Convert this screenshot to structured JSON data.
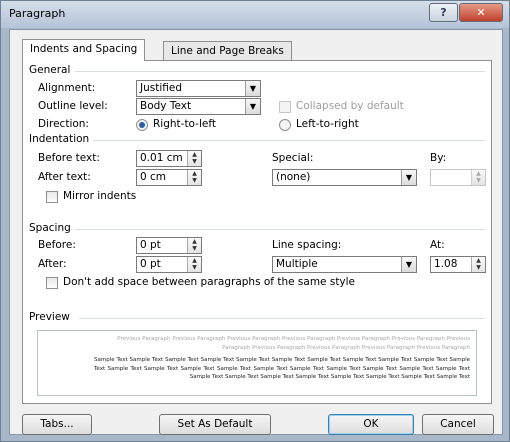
{
  "window": {
    "title": "Paragraph",
    "help_glyph": "?",
    "close_glyph": "✕"
  },
  "tabs": [
    {
      "label": "Indents and Spacing",
      "active": true
    },
    {
      "label": "Line and Page Breaks",
      "active": false
    }
  ],
  "general": {
    "heading": "General",
    "alignment_label": "Alignment:",
    "alignment_value": "Justified",
    "outline_label": "Outline level:",
    "outline_value": "Body Text",
    "collapsed_label": "Collapsed by default",
    "direction_label": "Direction:",
    "rtl_label": "Right-to-left",
    "ltr_label": "Left-to-right",
    "direction_value": "Right-to-left"
  },
  "indentation": {
    "heading": "Indentation",
    "before_label": "Before text:",
    "before_value": "0.01 cm",
    "after_label": "After text:",
    "after_value": "0 cm",
    "special_label": "Special:",
    "special_value": "(none)",
    "by_label": "By:",
    "by_value": "",
    "mirror_label": "Mirror indents"
  },
  "spacing": {
    "heading": "Spacing",
    "before_label": "Before:",
    "before_value": "0 pt",
    "after_label": "After:",
    "after_value": "0 pt",
    "line_spacing_label": "Line spacing:",
    "line_spacing_value": "Multiple",
    "at_label": "At:",
    "at_value": "1.08",
    "dont_add_label": "Don't add space between paragraphs of the same style"
  },
  "preview": {
    "heading": "Preview",
    "previous_text": "Previous Paragraph Previous Paragraph Previous Paragraph Previous Paragraph Previous Paragraph Previous Paragraph Previous Paragraph Previous Paragraph Previous Paragraph Previous Paragraph Previous Paragraph",
    "sample_text": "Sample Text Sample Text Sample Text Sample Text Sample Text Sample Text Sample Text Sample Text Sample Text Sample Text Sample Text Sample Text Sample Text Sample Text Sample Text Sample Text Sample Text Sample Text Sample Text Sample Text Sample Text Sample Text Sample Text Sample Text Sample Text Sample Text Sample Text Sample Text Sample Text"
  },
  "buttons": {
    "tabs": "Tabs...",
    "set_default": "Set As Default",
    "ok": "OK",
    "cancel": "Cancel"
  },
  "icons": {
    "dropdown": "chevron-down-icon",
    "spinner": "spinner-icon",
    "help": "help-icon",
    "close": "close-icon"
  }
}
